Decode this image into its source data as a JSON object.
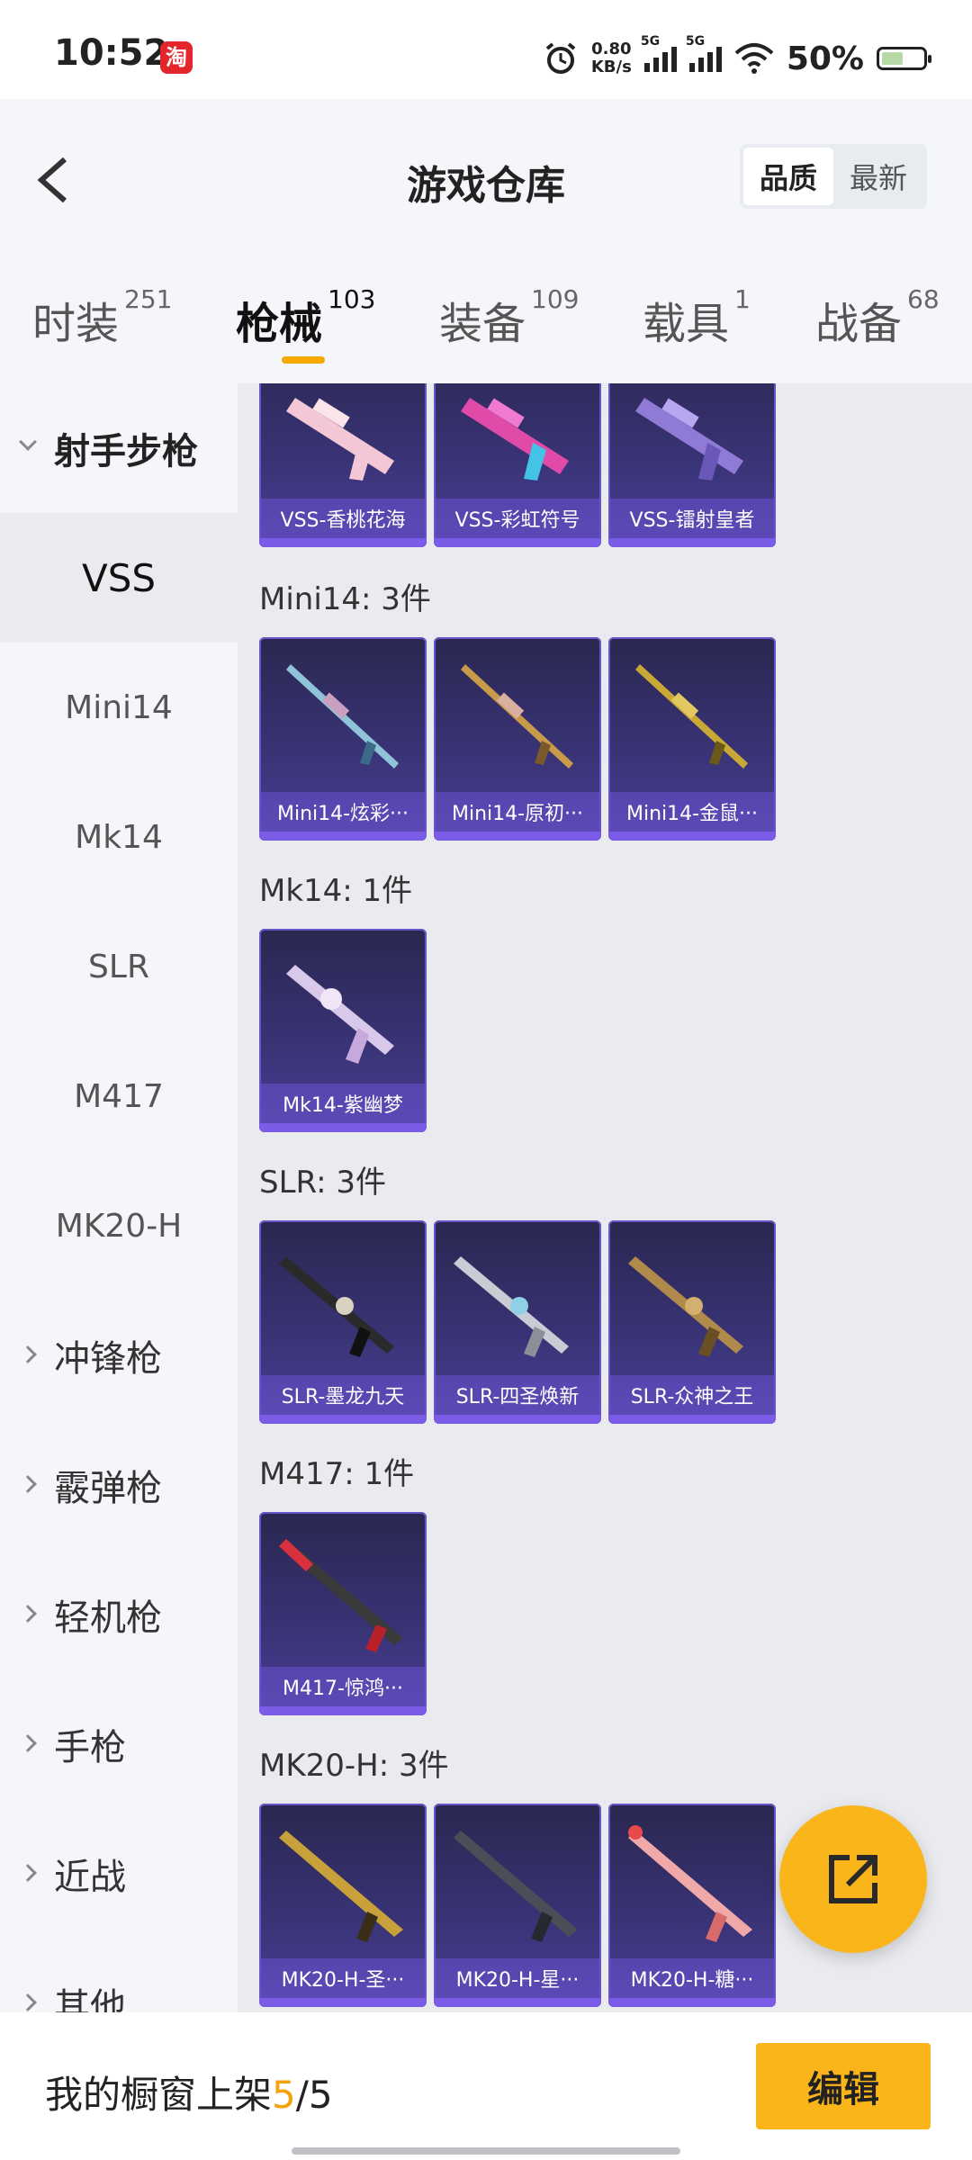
{
  "status_bar": {
    "time": "10:52",
    "app_badge": "淘",
    "net_speed_value": "0.80",
    "net_speed_unit": "KB/s",
    "signal1": "5G",
    "signal2": "5G",
    "battery_percent": "50%"
  },
  "header": {
    "title": "游戏仓库",
    "sort_options": [
      "品质",
      "最新"
    ],
    "active_sort": "品质"
  },
  "tabs": [
    {
      "label": "时装",
      "count": "251"
    },
    {
      "label": "枪械",
      "count": "103"
    },
    {
      "label": "装备",
      "count": "109"
    },
    {
      "label": "载具",
      "count": "1"
    },
    {
      "label": "战备",
      "count": "68"
    }
  ],
  "active_tab": "枪械",
  "sidebar": {
    "groups": [
      {
        "label": "射手步枪",
        "open": true
      },
      {
        "label": "冲锋枪"
      },
      {
        "label": "霰弹枪"
      },
      {
        "label": "轻机枪"
      },
      {
        "label": "手枪"
      },
      {
        "label": "近战"
      },
      {
        "label": "其他"
      }
    ],
    "sub_items": [
      "VSS",
      "Mini14",
      "Mk14",
      "SLR",
      "M417",
      "MK20-H"
    ],
    "active_sub": "VSS"
  },
  "sections": [
    {
      "title": "",
      "items": [
        "VSS-香桃花海",
        "VSS-彩虹符号",
        "VSS-镭射皇者"
      ]
    },
    {
      "title": "Mini14: 3件",
      "items": [
        "Mini14-炫彩···",
        "Mini14-原初···",
        "Mini14-金鼠···"
      ]
    },
    {
      "title": "Mk14: 1件",
      "items": [
        "Mk14-紫幽梦"
      ]
    },
    {
      "title": "SLR: 3件",
      "items": [
        "SLR-墨龙九天",
        "SLR-四圣焕新",
        "SLR-众神之王"
      ]
    },
    {
      "title": "M417: 1件",
      "items": [
        "M417-惊鸿···"
      ]
    },
    {
      "title": "MK20-H: 3件",
      "items": [
        "MK20-H-圣···",
        "MK20-H-星···",
        "MK20-H-糖···"
      ]
    }
  ],
  "bottom_bar": {
    "showcase_label": "我的橱窗上架",
    "showcase_current": "5",
    "showcase_total": "/5",
    "edit_label": "编辑"
  },
  "colors": {
    "accent": "#f9b51a",
    "card_bg": "#3a3478",
    "card_label": "#6b52d2"
  }
}
